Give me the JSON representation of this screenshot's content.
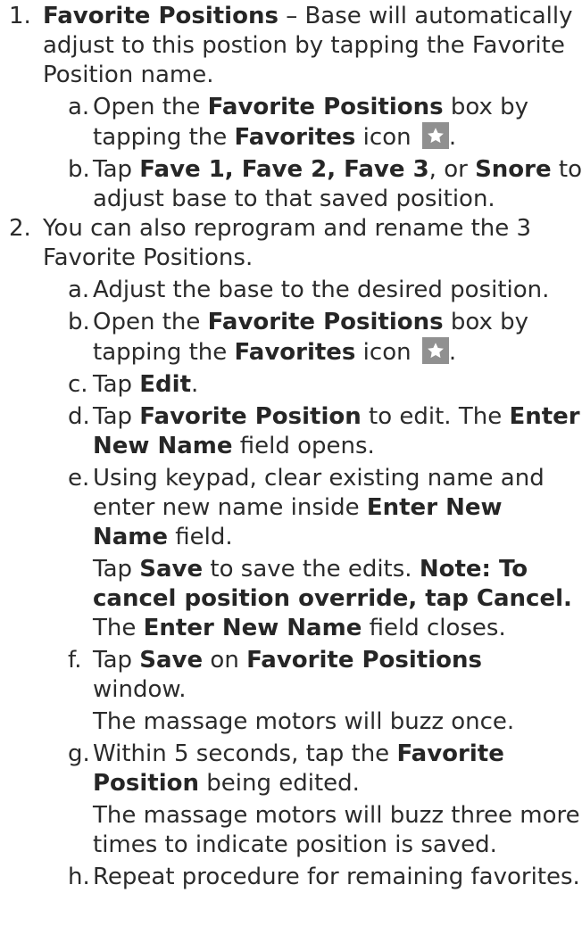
{
  "items": [
    {
      "num": "1.",
      "title": "Favorite Positions",
      "text": " – Base will automatically adjust to this postion by tapping the Favorite Position name.",
      "subs": [
        {
          "letter": "a.",
          "t1": "Open the ",
          "b1": "Favorite Positions",
          "t2": " box by tapping the ",
          "b2": "Favorites",
          "t3": " icon",
          "t4": "."
        },
        {
          "letter": "b.",
          "t1": "Tap ",
          "b1": "Fave 1, Fave 2, Fave 3",
          "t2": ", or ",
          "b2": "Snore",
          "t3": " to adjust base to that saved position."
        }
      ]
    },
    {
      "num": "2.",
      "text": "You can also reprogram and rename the 3 Favorite Positions.",
      "subs": [
        {
          "letter": "a.",
          "t1": "Adjust the base to the desired position."
        },
        {
          "letter": "b.",
          "t1": "Open the ",
          "b1": "Favorite Positions",
          "t2": " box by tapping the ",
          "b2": "Favorites",
          "t3": " icon",
          "t4": "."
        },
        {
          "letter": "c.",
          "t1": "Tap ",
          "b1": "Edit",
          "t2": "."
        },
        {
          "letter": "d.",
          "t1": "Tap ",
          "b1": "Favorite Position",
          "t2": " to edit. The ",
          "b2": "Enter New Name",
          "t3": " field opens."
        },
        {
          "letter": "e.",
          "t1": "Using keypad, clear existing name and enter new name inside ",
          "b1": "Enter New Name",
          "t2": " field.",
          "p_t1": "Tap ",
          "p_b1": "Save",
          "p_t2": " to save the edits. ",
          "p_b2": "Note: To cancel position override, tap Cancel.",
          "p_t3": " The ",
          "p_b3": "Enter New Name",
          "p_t4": " field closes."
        },
        {
          "letter": "f.",
          "t1": "Tap ",
          "b1": "Save",
          "t2": " on ",
          "b2": "Favorite Positions",
          "t3": " window.",
          "p_t1": "The massage motors will buzz once."
        },
        {
          "letter": "g.",
          "t1": "Within 5 seconds, tap the ",
          "b1": "Favorite Position",
          "t2": " being edited.",
          "p_t1": "The massage motors will buzz three more times to indicate position is saved."
        },
        {
          "letter": "h.",
          "t1": "Repeat procedure for remaining favorites."
        }
      ]
    }
  ],
  "icon": {
    "name": "favorites-star-icon",
    "bg_color": "#909090",
    "star_color": "#ffffff"
  }
}
